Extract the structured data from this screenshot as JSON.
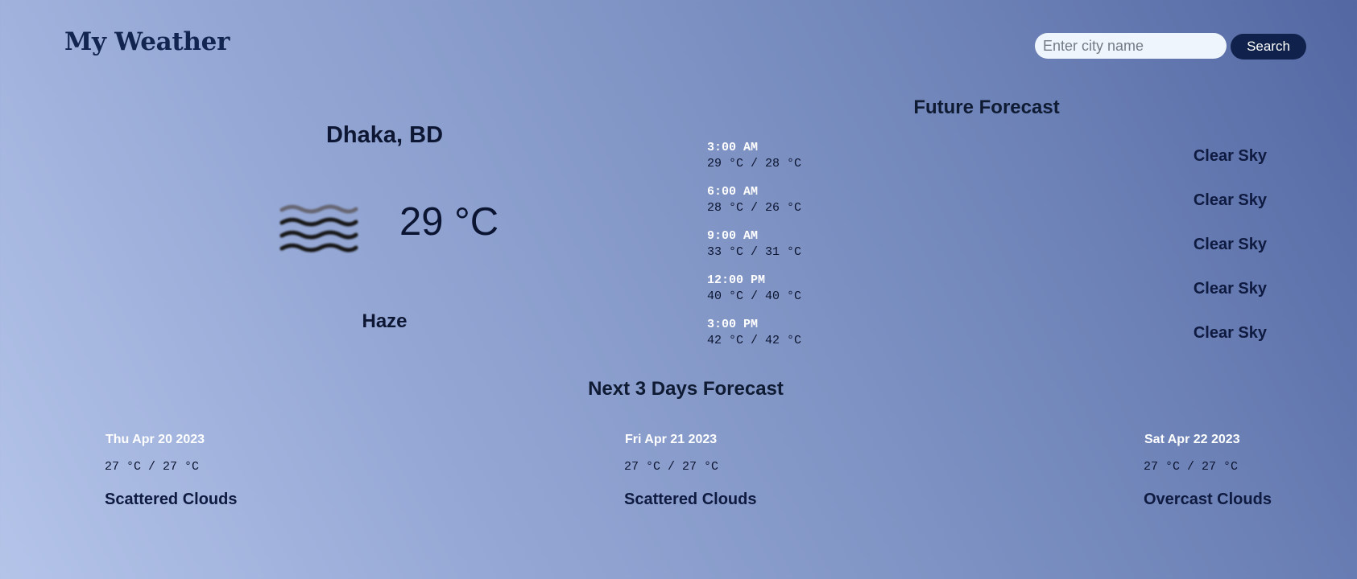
{
  "header": {
    "logo": "My Weather",
    "search_placeholder": "Enter city name",
    "search_value": "",
    "search_button": "Search"
  },
  "current": {
    "city": "Dhaka, BD",
    "temperature": "29 °C",
    "condition": "Haze",
    "icon": "haze-icon"
  },
  "future": {
    "title": "Future Forecast",
    "items": [
      {
        "time": "3:00 AM",
        "temps": "29 °C / 28 °C",
        "desc": "Clear Sky"
      },
      {
        "time": "6:00 AM",
        "temps": "28 °C / 26 °C",
        "desc": "Clear Sky"
      },
      {
        "time": "9:00 AM",
        "temps": "33 °C / 31 °C",
        "desc": "Clear Sky"
      },
      {
        "time": "12:00 PM",
        "temps": "40 °C / 40 °C",
        "desc": "Clear Sky"
      },
      {
        "time": "3:00 PM",
        "temps": "42 °C / 42 °C",
        "desc": "Clear Sky"
      }
    ]
  },
  "days": {
    "title": "Next 3 Days Forecast",
    "items": [
      {
        "date": "Thu Apr 20 2023",
        "temps": "27 °C / 27 °C",
        "desc": "Scattered Clouds"
      },
      {
        "date": "Fri Apr 21 2023",
        "temps": "27 °C / 27 °C",
        "desc": "Scattered Clouds"
      },
      {
        "date": "Sat Apr 22 2023",
        "temps": "27 °C / 27 °C",
        "desc": "Overcast Clouds"
      }
    ]
  },
  "colors": {
    "accent": "#10224b",
    "logo": "#122450",
    "background_start": "#b4c4e9",
    "background_end": "#5367a3"
  }
}
